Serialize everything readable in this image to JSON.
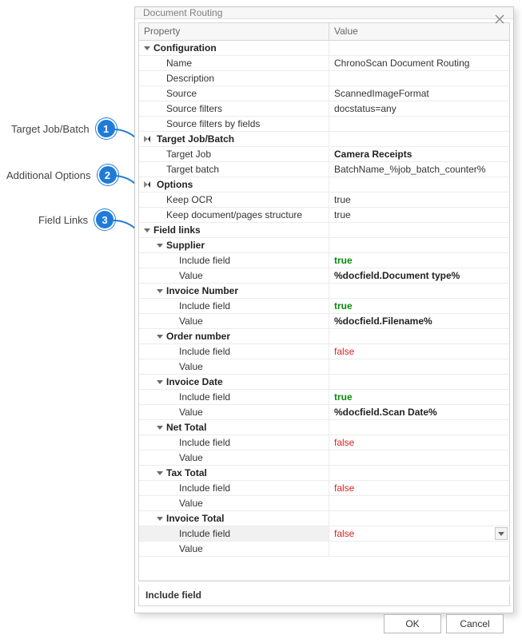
{
  "dialog": {
    "title": "Document Routing"
  },
  "columns": {
    "property": "Property",
    "value": "Value"
  },
  "sections": {
    "configuration": {
      "label": "Configuration"
    },
    "targetJobBatch": {
      "label": "Target Job/Batch"
    },
    "options": {
      "label": "Options"
    },
    "fieldLinks": {
      "label": "Field links"
    }
  },
  "config": {
    "name": {
      "label": "Name",
      "value": "ChronoScan Document Routing"
    },
    "description": {
      "label": "Description",
      "value": ""
    },
    "source": {
      "label": "Source",
      "value": "ScannedImageFormat"
    },
    "sourceFilters": {
      "label": "Source filters",
      "value": "docstatus=any"
    },
    "sourceFiltersByFields": {
      "label": "Source filters by fields",
      "value": ""
    }
  },
  "target": {
    "job": {
      "label": "Target Job",
      "value": "Camera Receipts"
    },
    "batch": {
      "label": "Target batch",
      "value": "BatchName_%job_batch_counter%"
    }
  },
  "options": {
    "keepOcr": {
      "label": "Keep OCR",
      "value": "true"
    },
    "keepStructure": {
      "label": "Keep document/pages structure",
      "value": "true"
    }
  },
  "links": {
    "supplier": {
      "label": "Supplier",
      "include": "true",
      "value": "%docfield.Document type%"
    },
    "invoiceNumber": {
      "label": "Invoice Number",
      "include": "true",
      "value": "%docfield.Filename%"
    },
    "orderNumber": {
      "label": "Order number",
      "include": "false",
      "value": ""
    },
    "invoiceDate": {
      "label": "Invoice Date",
      "include": "true",
      "value": "%docfield.Scan Date%"
    },
    "netTotal": {
      "label": "Net Total",
      "include": "false",
      "value": ""
    },
    "taxTotal": {
      "label": "Tax Total",
      "include": "false",
      "value": ""
    },
    "invoiceTotal": {
      "label": "Invoice Total",
      "include": "false",
      "value": ""
    }
  },
  "labels": {
    "includeField": "Include field",
    "valueField": "Value"
  },
  "description": {
    "title": "Include field"
  },
  "buttons": {
    "ok": "OK",
    "cancel": "Cancel"
  },
  "callouts": {
    "c1": {
      "num": "1",
      "label": "Target Job/Batch"
    },
    "c2": {
      "num": "2",
      "label": "Additional Options"
    },
    "c3": {
      "num": "3",
      "label": "Field Links"
    }
  }
}
